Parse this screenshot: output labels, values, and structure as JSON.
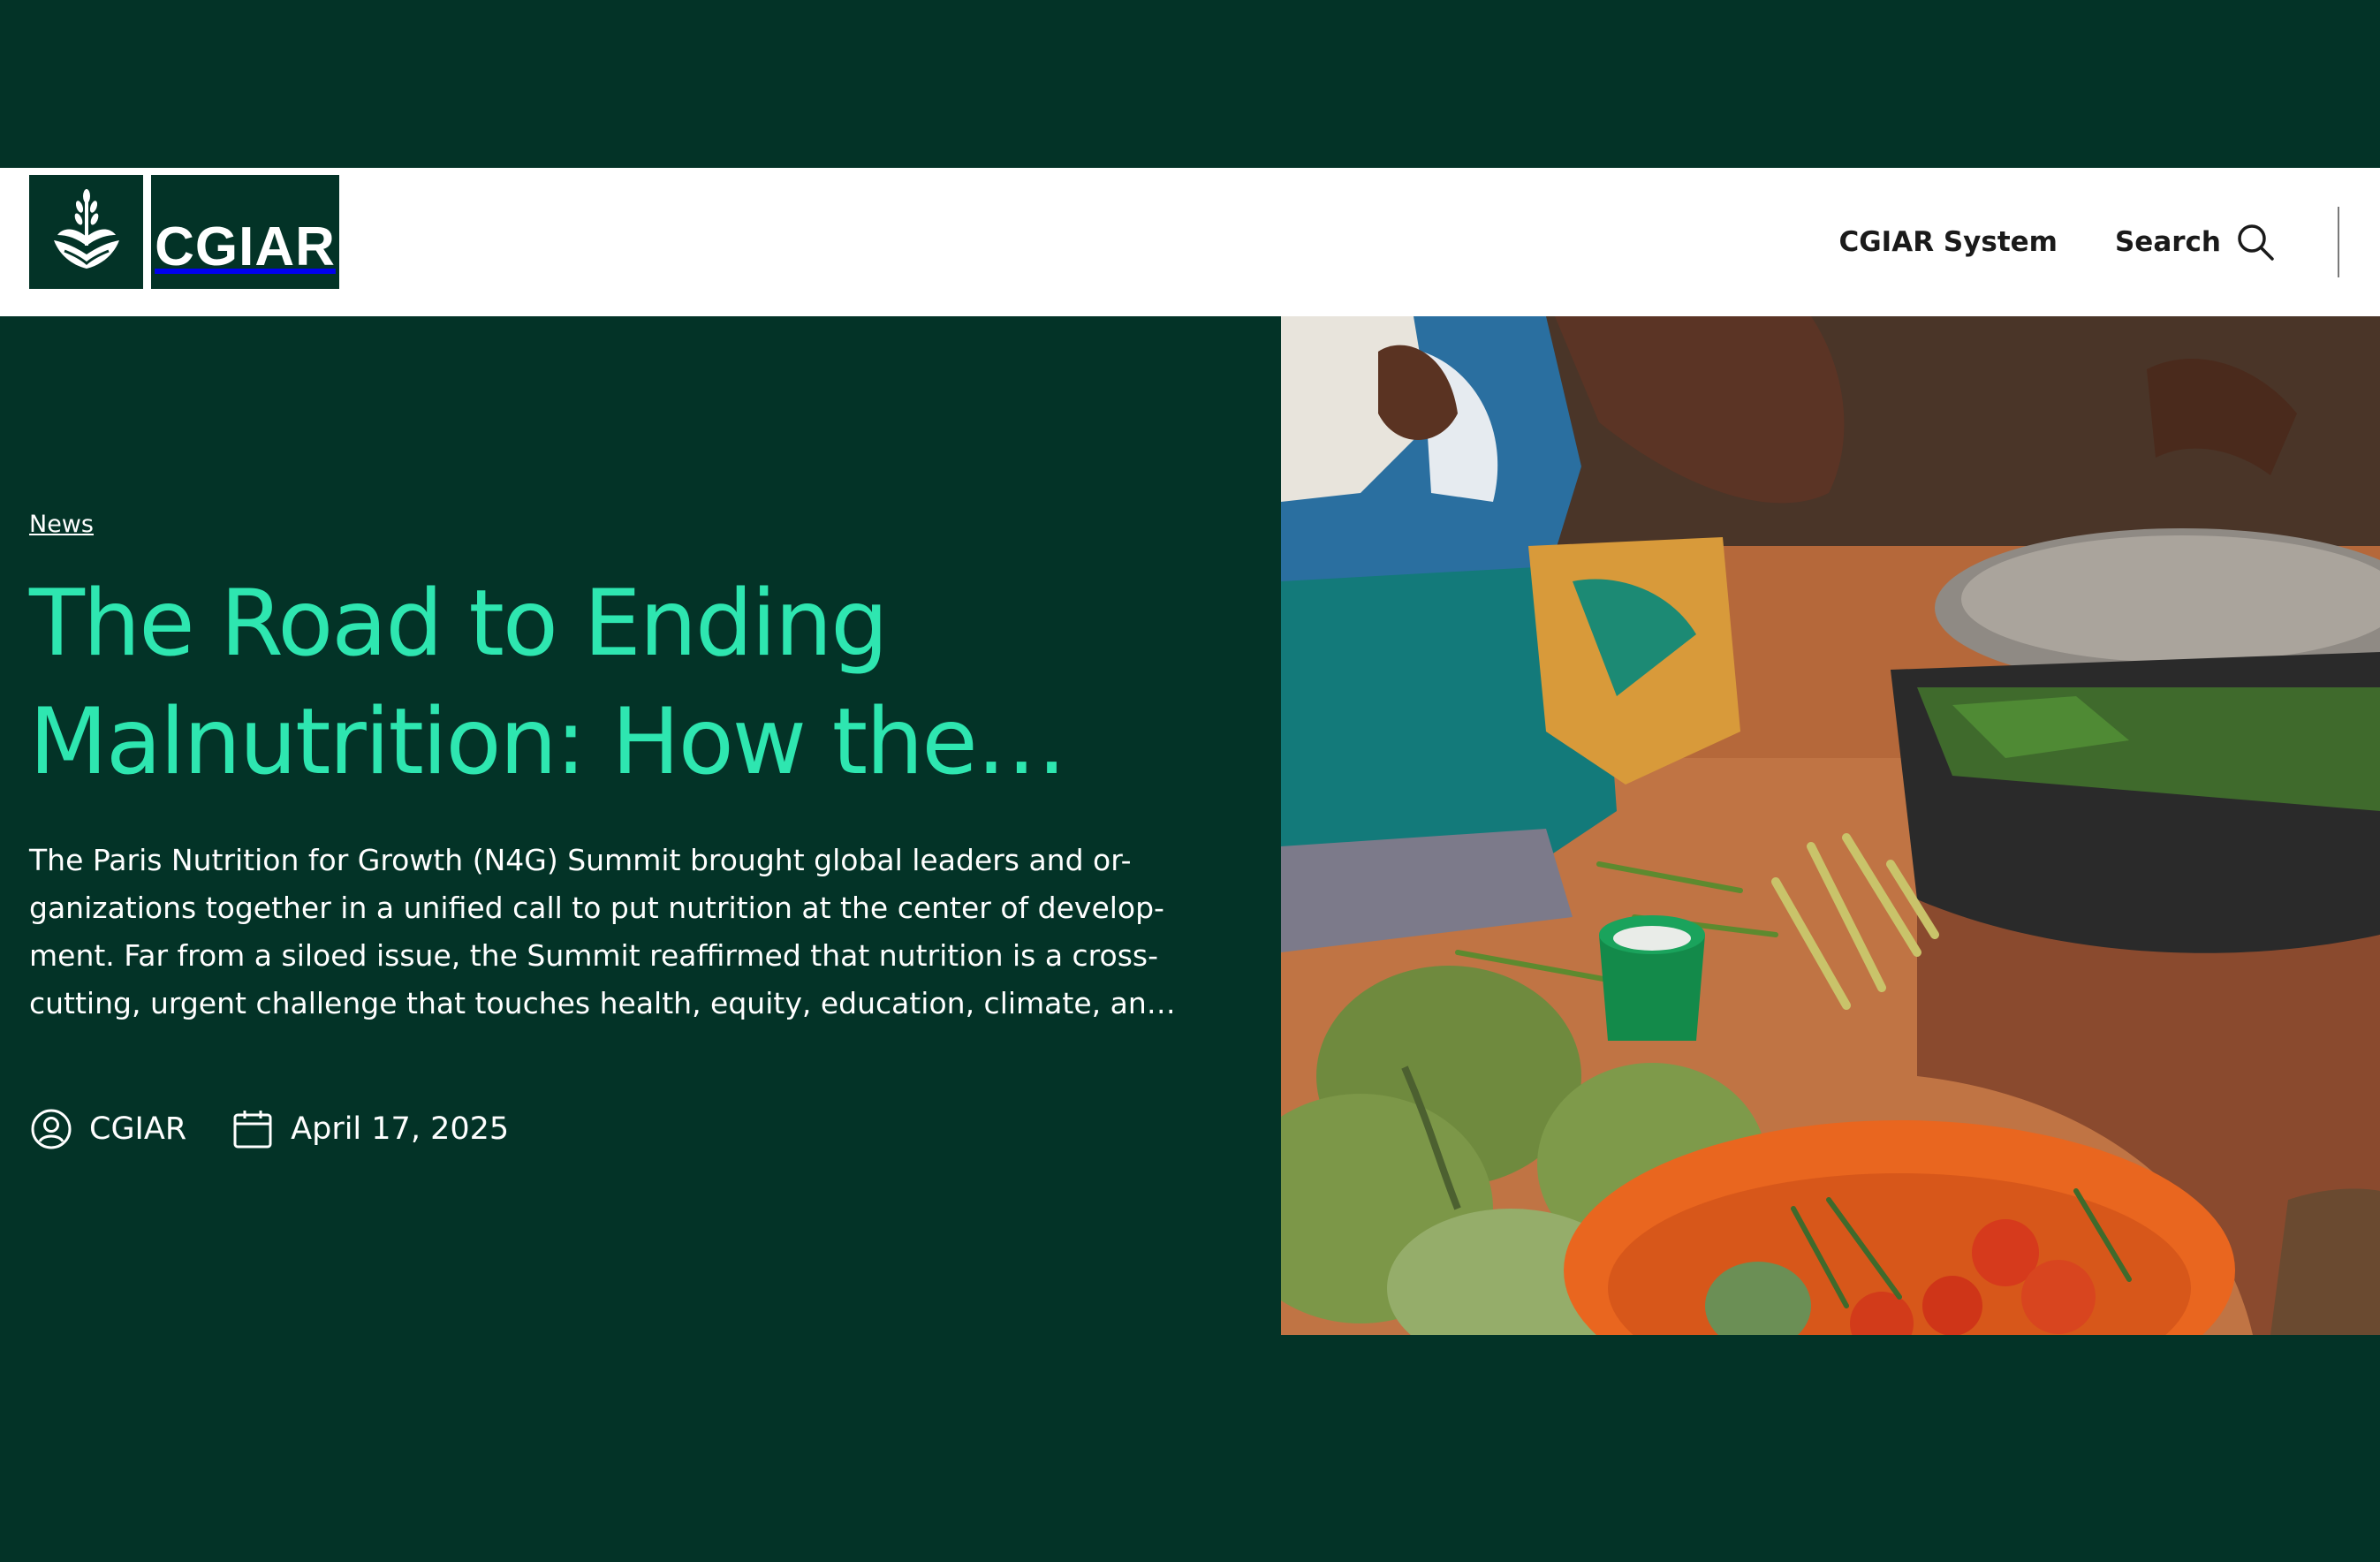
{
  "header": {
    "logo_text": "CGIAR",
    "nav": {
      "system_label": "CGIAR System",
      "search_label": "Search"
    }
  },
  "article": {
    "category": "News",
    "title": "The Road to Ending Malnutrition: How the…",
    "excerpt": "The Paris Nutrition for Growth (N4G) Summit brought global leaders and or-ganizations together in a unified call to put nutrition at the center of develop-ment. Far from a siloed issue, the Summit reaffirmed that nutrition is a cross-cutting, urgent challenge that touches health, equity, education, climate, an…",
    "author": "CGIAR",
    "date": "April 17, 2025"
  },
  "icons": {
    "search": "search-icon",
    "author": "user-circle-icon",
    "date": "calendar-icon",
    "logo": "wheat-hands-icon"
  },
  "colors": {
    "brand_dark_green": "#033327",
    "headline_accent": "#2ee6b0",
    "header_bg": "#ffffff"
  }
}
